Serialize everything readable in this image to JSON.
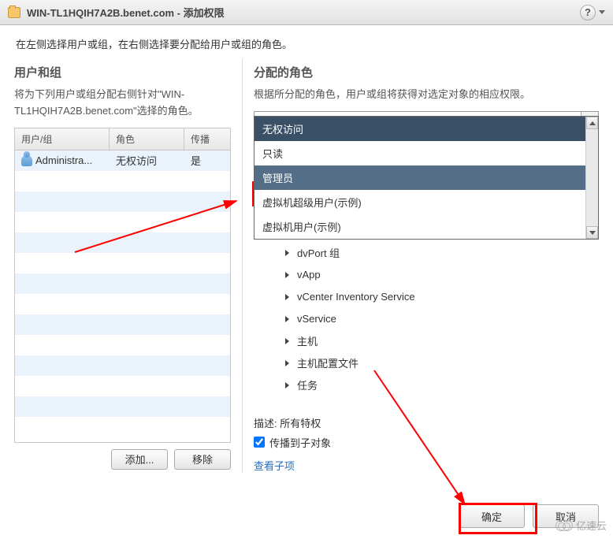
{
  "titlebar": {
    "title": "WIN-TL1HQIH7A2B.benet.com - 添加权限"
  },
  "instruction": "在左侧选择用户或组，在右侧选择要分配给用户或组的角色。",
  "left": {
    "heading": "用户和组",
    "desc": "将为下列用户或组分配右侧针对\"WIN-TL1HQIH7A2B.benet.com\"选择的角色。",
    "headers": {
      "c1": "用户/组",
      "c2": "角色",
      "c3": "传播"
    },
    "rows": [
      {
        "user": "Administra...",
        "role": "无权访问",
        "prop": "是"
      }
    ],
    "add": "添加...",
    "remove": "移除"
  },
  "right": {
    "heading": "分配的角色",
    "desc": "根据所分配的角色，用户或组将获得对选定对象的相应权限。",
    "selected": "无权访问",
    "options": [
      "无权访问",
      "只读",
      "管理员",
      "虚拟机超级用户(示例)",
      "虚拟机用户(示例)"
    ],
    "tree": [
      "dvPort 组",
      "vApp",
      "vCenter Inventory Service",
      "vService",
      "主机",
      "主机配置文件",
      "任务"
    ],
    "priv_label": "描述:",
    "priv_value": "所有特权",
    "propagate": "传播到子对象",
    "view_children": "查看子项"
  },
  "footer": {
    "ok": "确定",
    "cancel": "取消"
  },
  "watermark": "亿速云"
}
